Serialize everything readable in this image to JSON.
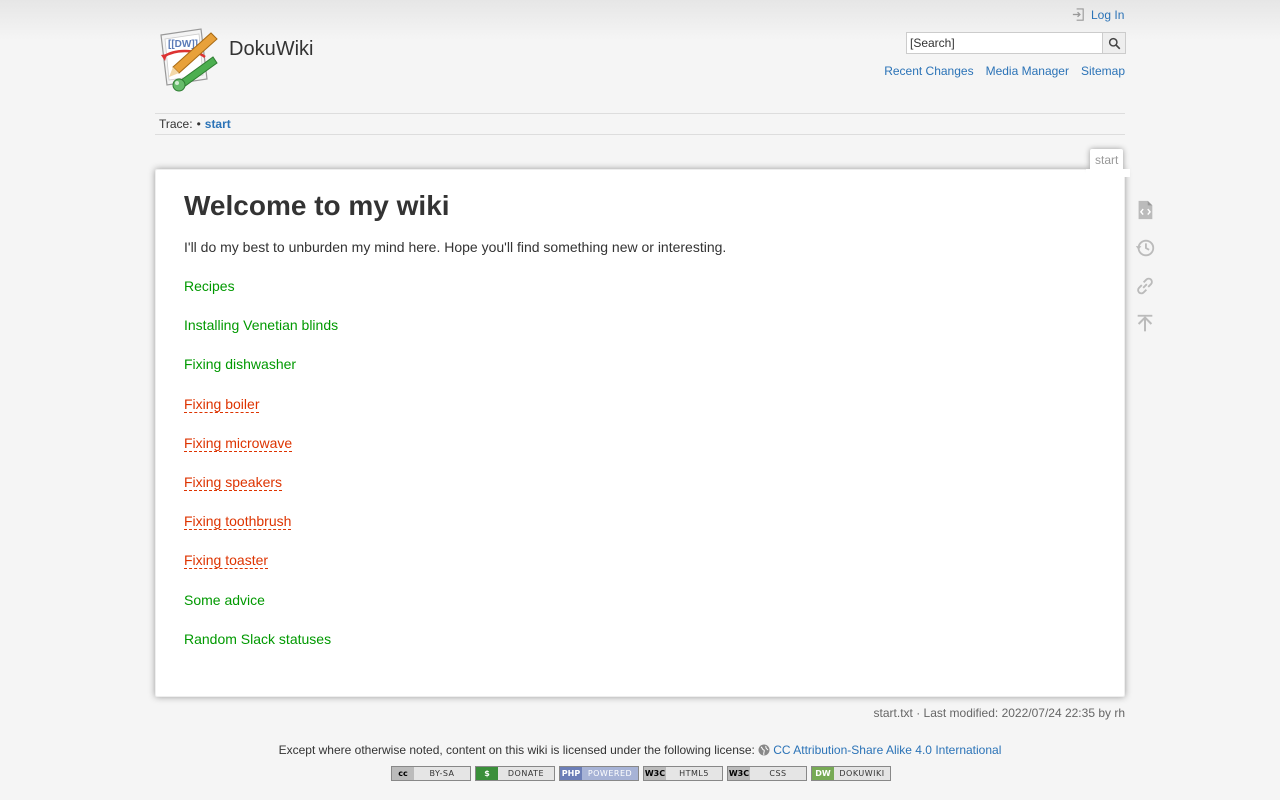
{
  "site": {
    "title": "DokuWiki"
  },
  "header": {
    "login_label": "Log In",
    "search": {
      "placeholder": "[Search]",
      "button_label": "Search"
    },
    "links": [
      "Recent Changes",
      "Media Manager",
      "Sitemap"
    ]
  },
  "breadcrumbs": {
    "label": "Trace:",
    "separator": "•",
    "current": "start"
  },
  "page": {
    "id": "start",
    "title": "Welcome to my wiki",
    "intro": "I'll do my best to unburden my mind here. Hope you'll find something new or interesting.",
    "links": [
      {
        "label": "Recipes",
        "exists": true
      },
      {
        "label": "Installing Venetian blinds",
        "exists": true
      },
      {
        "label": "Fixing dishwasher",
        "exists": true
      },
      {
        "label": "Fixing boiler",
        "exists": false
      },
      {
        "label": "Fixing microwave",
        "exists": false
      },
      {
        "label": "Fixing speakers",
        "exists": false
      },
      {
        "label": "Fixing toothbrush",
        "exists": false
      },
      {
        "label": "Fixing toaster",
        "exists": false
      },
      {
        "label": "Some advice",
        "exists": true
      },
      {
        "label": "Random Slack statuses",
        "exists": true
      }
    ]
  },
  "page_tools": [
    {
      "name": "show-source",
      "icon": "code-file-icon"
    },
    {
      "name": "old-revisions",
      "icon": "history-icon"
    },
    {
      "name": "backlinks",
      "icon": "link-icon"
    },
    {
      "name": "back-to-top",
      "icon": "arrow-up-icon"
    }
  ],
  "doc_info": {
    "file": "start.txt",
    "text": " · Last modified: 2022/07/24 22:35 by rh"
  },
  "footer": {
    "license_text": "Except where otherwise noted, content on this wiki is licensed under the following license: ",
    "license_link": "CC Attribution-Share Alike 4.0 International",
    "badges": [
      {
        "name": "cc-by-sa",
        "left": "cc",
        "right": "BY-SA"
      },
      {
        "name": "donate",
        "left": "$",
        "right": "DONATE"
      },
      {
        "name": "php",
        "left": "PHP",
        "right": "POWERED"
      },
      {
        "name": "html5",
        "left": "W3C",
        "right": "HTML5"
      },
      {
        "name": "css",
        "left": "W3C",
        "right": "CSS"
      },
      {
        "name": "dokuwiki",
        "left": "DW",
        "right": "DOKUWIKI"
      }
    ]
  },
  "colors": {
    "link": "#2b73b7",
    "existing_page_link": "#009900",
    "missing_page_link": "#dd3300",
    "background": "#f5f5f5"
  }
}
